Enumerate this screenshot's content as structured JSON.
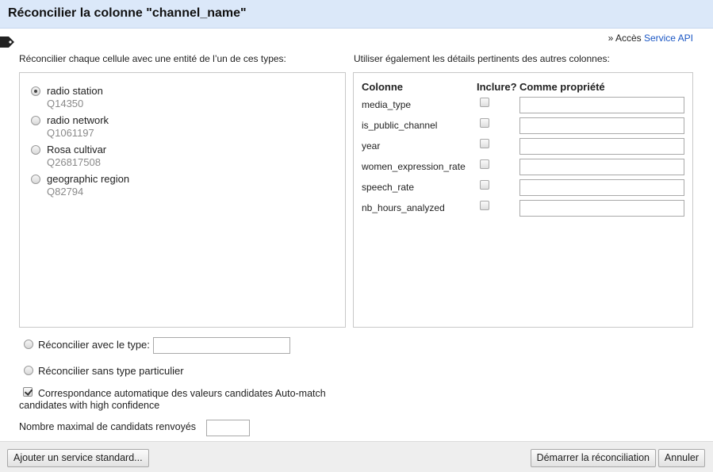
{
  "dialog": {
    "title": "Réconcilier la colonne \"channel_name\""
  },
  "api": {
    "prefix": "» Accès",
    "link": "Service API"
  },
  "types_panel": {
    "label": "Réconcilier chaque cellule avec une entité de l’un de ces types:",
    "items": [
      {
        "name": "radio station",
        "id": "Q14350",
        "selected": true
      },
      {
        "name": "radio network",
        "id": "Q1061197",
        "selected": false
      },
      {
        "name": "Rosa cultivar",
        "id": "Q26817508",
        "selected": false
      },
      {
        "name": "geographic region",
        "id": "Q82794",
        "selected": false
      }
    ]
  },
  "columns_panel": {
    "label": "Utiliser également les détails pertinents des autres colonnes:",
    "headers": {
      "column": "Colonne",
      "include": "Inclure?",
      "property": "Comme propriété"
    },
    "rows": [
      {
        "name": "media_type",
        "include": false,
        "property": ""
      },
      {
        "name": "is_public_channel",
        "include": false,
        "property": ""
      },
      {
        "name": "year",
        "include": false,
        "property": ""
      },
      {
        "name": "women_expression_rate",
        "include": false,
        "property": ""
      },
      {
        "name": "speech_rate",
        "include": false,
        "property": ""
      },
      {
        "name": "nb_hours_analyzed",
        "include": false,
        "property": ""
      }
    ]
  },
  "options": {
    "with_type_label": "Réconcilier avec le type:",
    "with_type_value": "",
    "without_type_label": "Réconcilier sans type particulier",
    "auto_match_label": "Correspondance automatique des valeurs candidates Auto-match candidates with high confidence",
    "auto_match_checked": true,
    "max_candidates_label": "Nombre maximal de candidats renvoyés",
    "max_candidates_value": ""
  },
  "footer": {
    "add_service": "Ajouter un service standard...",
    "start": "Démarrer la réconciliation",
    "cancel": "Annuler"
  }
}
